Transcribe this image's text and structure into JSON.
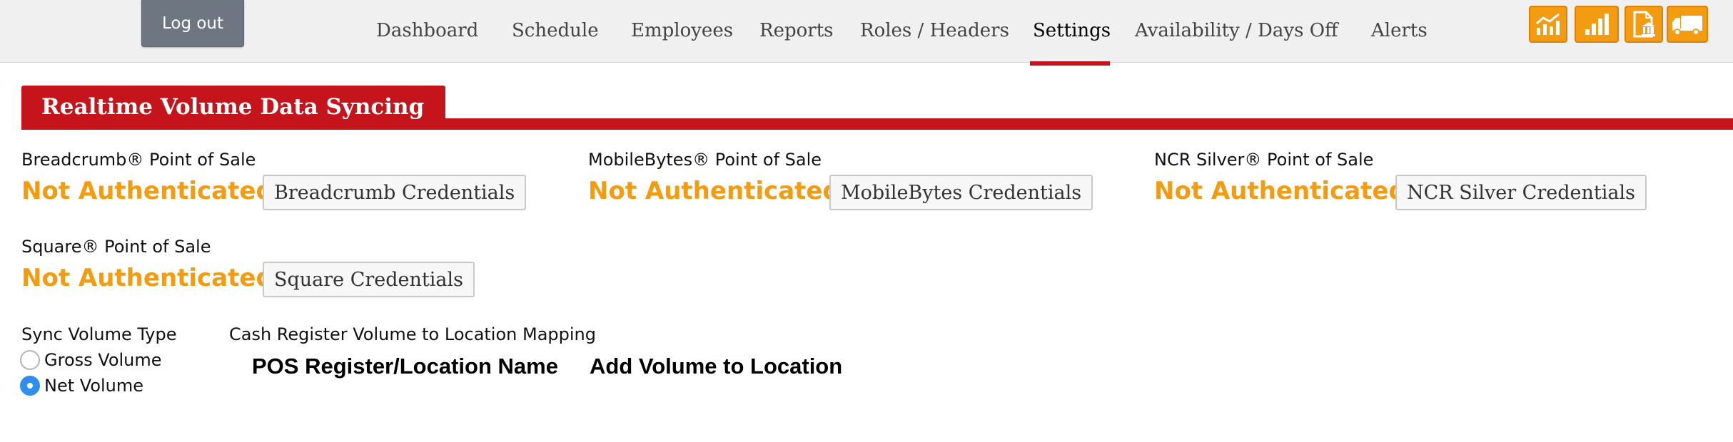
{
  "header": {
    "logout_label": "Log out",
    "nav": [
      {
        "label": "Dashboard",
        "active": false
      },
      {
        "label": "Schedule",
        "active": false
      },
      {
        "label": "Employees",
        "active": false
      },
      {
        "label": "Reports",
        "active": false
      },
      {
        "label": "Roles / Headers",
        "active": false
      },
      {
        "label": "Settings",
        "active": true
      },
      {
        "label": "Availability / Days Off",
        "active": false
      },
      {
        "label": "Alerts",
        "active": false
      }
    ],
    "icons": [
      "line-chart-icon",
      "bar-chart-icon",
      "document-bank-icon",
      "truck-icon"
    ],
    "accent_color": "#c5141c",
    "icon_color": "#f39c12"
  },
  "section": {
    "title": "Realtime Volume Data Syncing"
  },
  "pos": [
    {
      "name": "Breadcrumb® Point of Sale",
      "status": "Not Authenticated",
      "button": "Breadcrumb Credentials"
    },
    {
      "name": "MobileBytes® Point of Sale",
      "status": "Not Authenticated",
      "button": "MobileBytes Credentials"
    },
    {
      "name": "NCR Silver® Point of Sale",
      "status": "Not Authenticated",
      "button": "NCR Silver Credentials"
    },
    {
      "name": "Square® Point of Sale",
      "status": "Not Authenticated",
      "button": "Square Credentials"
    }
  ],
  "status_color": "#f39c12",
  "sync": {
    "label": "Sync Volume Type",
    "options": [
      {
        "label": "Gross Volume",
        "selected": false
      },
      {
        "label": "Net Volume",
        "selected": true
      }
    ]
  },
  "mapping": {
    "label": "Cash Register Volume to Location Mapping",
    "columns": [
      "POS Register/Location Name",
      "Add Volume to Location"
    ]
  }
}
